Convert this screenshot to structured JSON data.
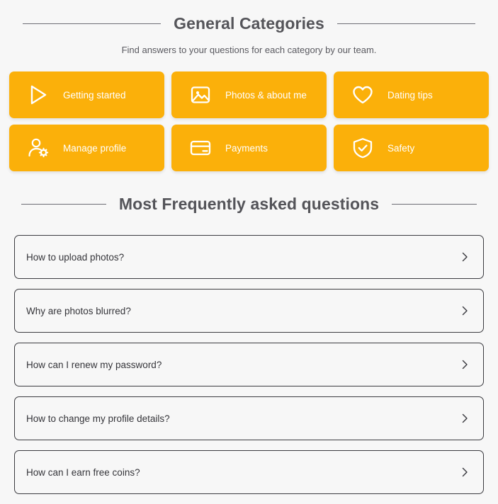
{
  "categories_section": {
    "title": "General Categories",
    "subtitle": "Find answers to your questions for each category by our team.",
    "tiles": [
      {
        "label": "Getting started",
        "icon": "play-icon"
      },
      {
        "label": "Photos & about me",
        "icon": "image-icon"
      },
      {
        "label": "Dating tips",
        "icon": "heart-icon"
      },
      {
        "label": "Manage profile",
        "icon": "user-gear-icon"
      },
      {
        "label": "Payments",
        "icon": "credit-card-icon"
      },
      {
        "label": "Safety",
        "icon": "shield-check-icon"
      }
    ]
  },
  "faq_section": {
    "title": "Most Frequently asked questions",
    "items": [
      {
        "question": "How to upload photos?"
      },
      {
        "question": "Why are photos blurred?"
      },
      {
        "question": "How can I renew my password?"
      },
      {
        "question": "How to change my profile details?"
      },
      {
        "question": "How can I earn free coins?"
      }
    ]
  },
  "colors": {
    "tile_background": "#FBB00A",
    "page_background": "#F7F7F7",
    "heading_text": "#545459",
    "tile_text": "#FFFFFF",
    "faq_border": "#3B3B40"
  }
}
